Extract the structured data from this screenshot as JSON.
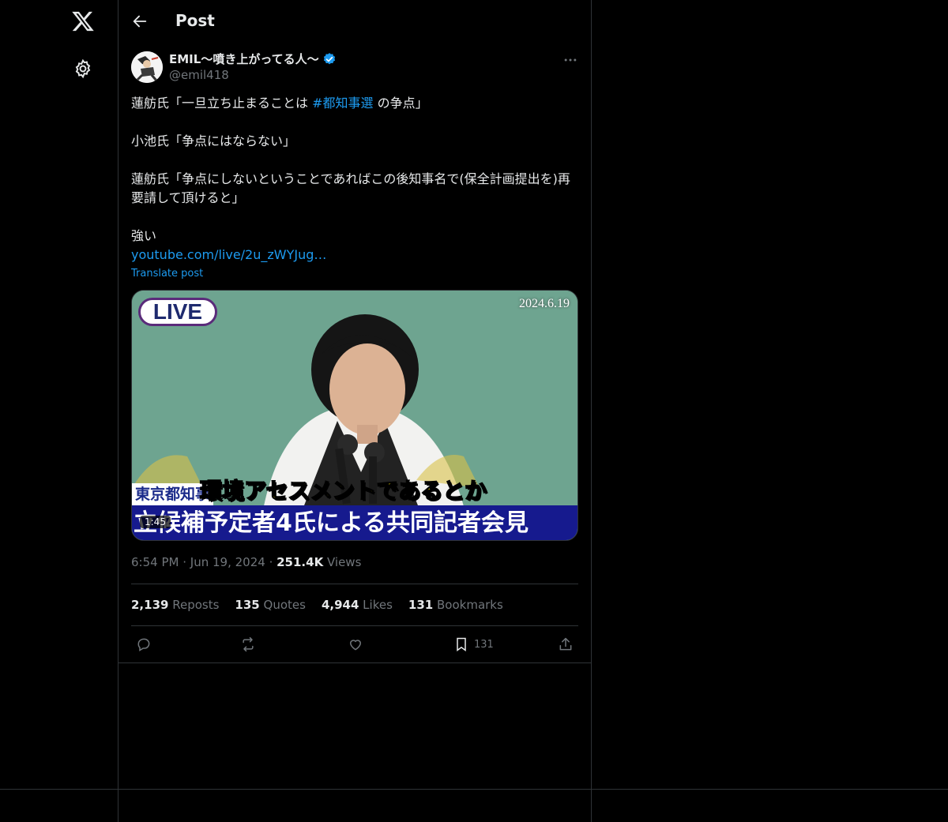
{
  "header": {
    "title": "Post"
  },
  "author": {
    "name": "EMIL〜噴き上がってる人〜",
    "handle": "@emil418"
  },
  "tweet": {
    "line1_pre": "蓮舫氏「一旦立ち止まることは ",
    "line1_hashtag": "#都知事選",
    "line1_post": " の争点」",
    "line2": "小池氏「争点にはならない」",
    "line3": "蓮舫氏「争点にしないということであればこの後知事名で(保全計画提出を)再要請して頂けると」",
    "line4": "強い",
    "link": "youtube.com/live/2u_zWYJug…",
    "translate": "Translate post"
  },
  "media": {
    "live_label": "LIVE",
    "date": "2024.6.19",
    "caption_yellow": "環境アセスメントであるとか",
    "caption_small": "東京都知事",
    "caption_band": "立候補予定者4氏による共同記者会見",
    "duration": "1:45"
  },
  "meta": {
    "time": "6:54 PM",
    "date": "Jun 19, 2024",
    "views_count": "251.4K",
    "views_label": "Views"
  },
  "stats": {
    "reposts_count": "2,139",
    "reposts_label": "Reposts",
    "quotes_count": "135",
    "quotes_label": "Quotes",
    "likes_count": "4,944",
    "likes_label": "Likes",
    "bookmarks_count": "131",
    "bookmarks_label": "Bookmarks"
  },
  "actions": {
    "bookmark_count": "131"
  },
  "colors": {
    "accent": "#1d9bf0",
    "text": "#e7e9ea",
    "muted": "#71767b",
    "border": "#2f3336",
    "background": "#000000"
  }
}
